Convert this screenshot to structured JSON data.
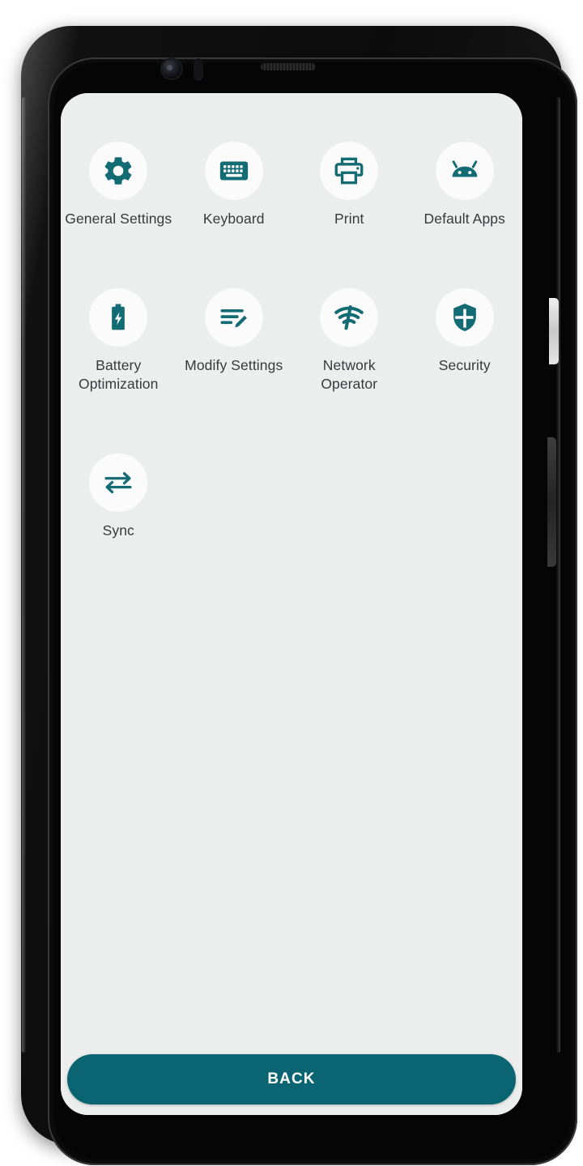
{
  "device": {
    "hardware": {
      "front_camera": "front-camera",
      "proximity_sensor": "proximity-sensor",
      "earpiece_speaker": "earpiece-speaker",
      "volume_button": "volume-button",
      "power_button": "power-button"
    }
  },
  "theme": {
    "accent_teal": "#0b6471",
    "icon_teal": "#136B74",
    "screen_background": "#eceded",
    "icon_circle_background": "#fbfbfb",
    "label_text": "#39393b",
    "button_text": "#ffffff"
  },
  "screen": {
    "grid": {
      "columns": 4,
      "items": [
        {
          "label": "General Settings",
          "icon": "gear-icon"
        },
        {
          "label": "Keyboard",
          "icon": "keyboard-icon"
        },
        {
          "label": "Print",
          "icon": "printer-icon"
        },
        {
          "label": "Default Apps",
          "icon": "android-robot-icon"
        },
        {
          "label": "Battery Optimization",
          "icon": "battery-charging-icon"
        },
        {
          "label": "Modify Settings",
          "icon": "edit-lines-pencil-icon"
        },
        {
          "label": "Network Operator",
          "icon": "network-signal-icon"
        },
        {
          "label": "Security",
          "icon": "shield-cross-icon"
        },
        {
          "label": "Sync",
          "icon": "sync-arrows-icon"
        }
      ]
    },
    "footer": {
      "back_label": "BACK"
    }
  }
}
